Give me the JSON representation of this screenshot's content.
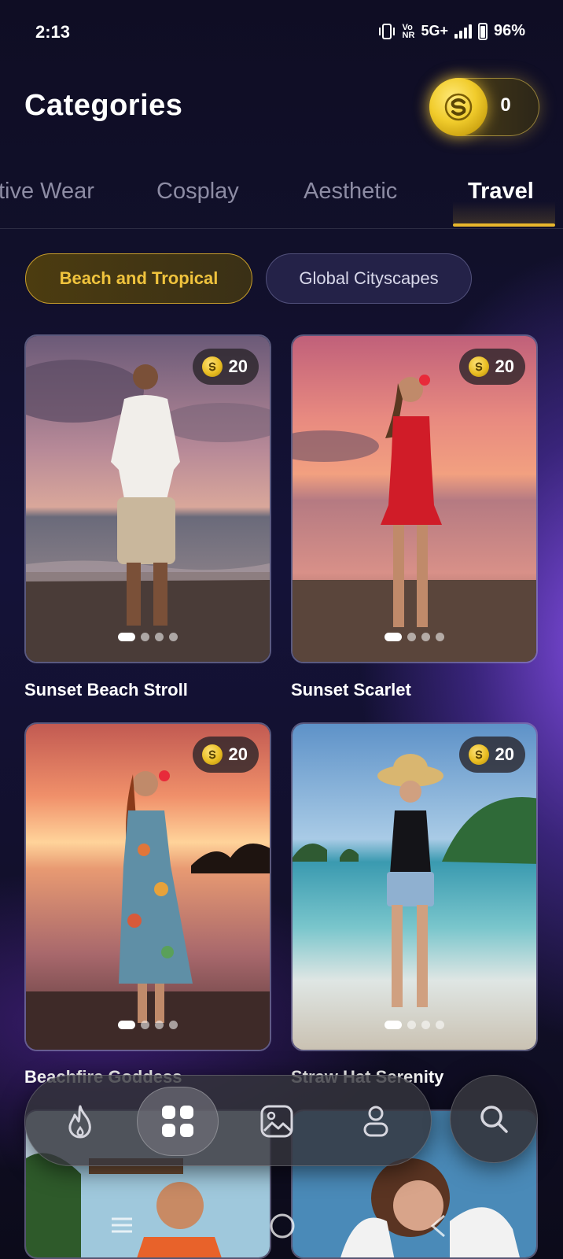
{
  "status_bar": {
    "time": "2:13",
    "network_top": "Vo",
    "network_bottom": "NR",
    "network_type": "5G+",
    "battery": "96%"
  },
  "header": {
    "title": "Categories",
    "coin_balance": "0"
  },
  "tabs": [
    {
      "label": "Active Wear",
      "visible_label": "tive Wear",
      "active": false
    },
    {
      "label": "Cosplay",
      "active": false
    },
    {
      "label": "Aesthetic",
      "active": false
    },
    {
      "label": "Travel",
      "active": true
    }
  ],
  "chips": [
    {
      "label": "Beach and Tropical",
      "active": true
    },
    {
      "label": "Global Cityscapes",
      "active": false
    }
  ],
  "cards": [
    {
      "title": "Sunset Beach Stroll",
      "cost": "20",
      "slide_count": 4,
      "active_slide": 1
    },
    {
      "title": "Sunset Scarlet",
      "cost": "20",
      "slide_count": 4,
      "active_slide": 1
    },
    {
      "title": "Beachfire Goddess",
      "cost": "20",
      "slide_count": 4,
      "active_slide": 1
    },
    {
      "title": "Straw Hat Serenity",
      "cost": "20",
      "slide_count": 4,
      "active_slide": 1
    }
  ],
  "bottom_nav": {
    "items": [
      {
        "icon": "flame-icon",
        "active": false
      },
      {
        "icon": "grid-icon",
        "active": true
      },
      {
        "icon": "image-icon",
        "active": false
      },
      {
        "icon": "person-icon",
        "active": false
      }
    ],
    "search_icon": "search-icon"
  },
  "colors": {
    "accent_gold": "#e8b72c",
    "chip_active_text": "#f0c33d",
    "background": "#12102c",
    "glow_purple": "#844ee6"
  }
}
